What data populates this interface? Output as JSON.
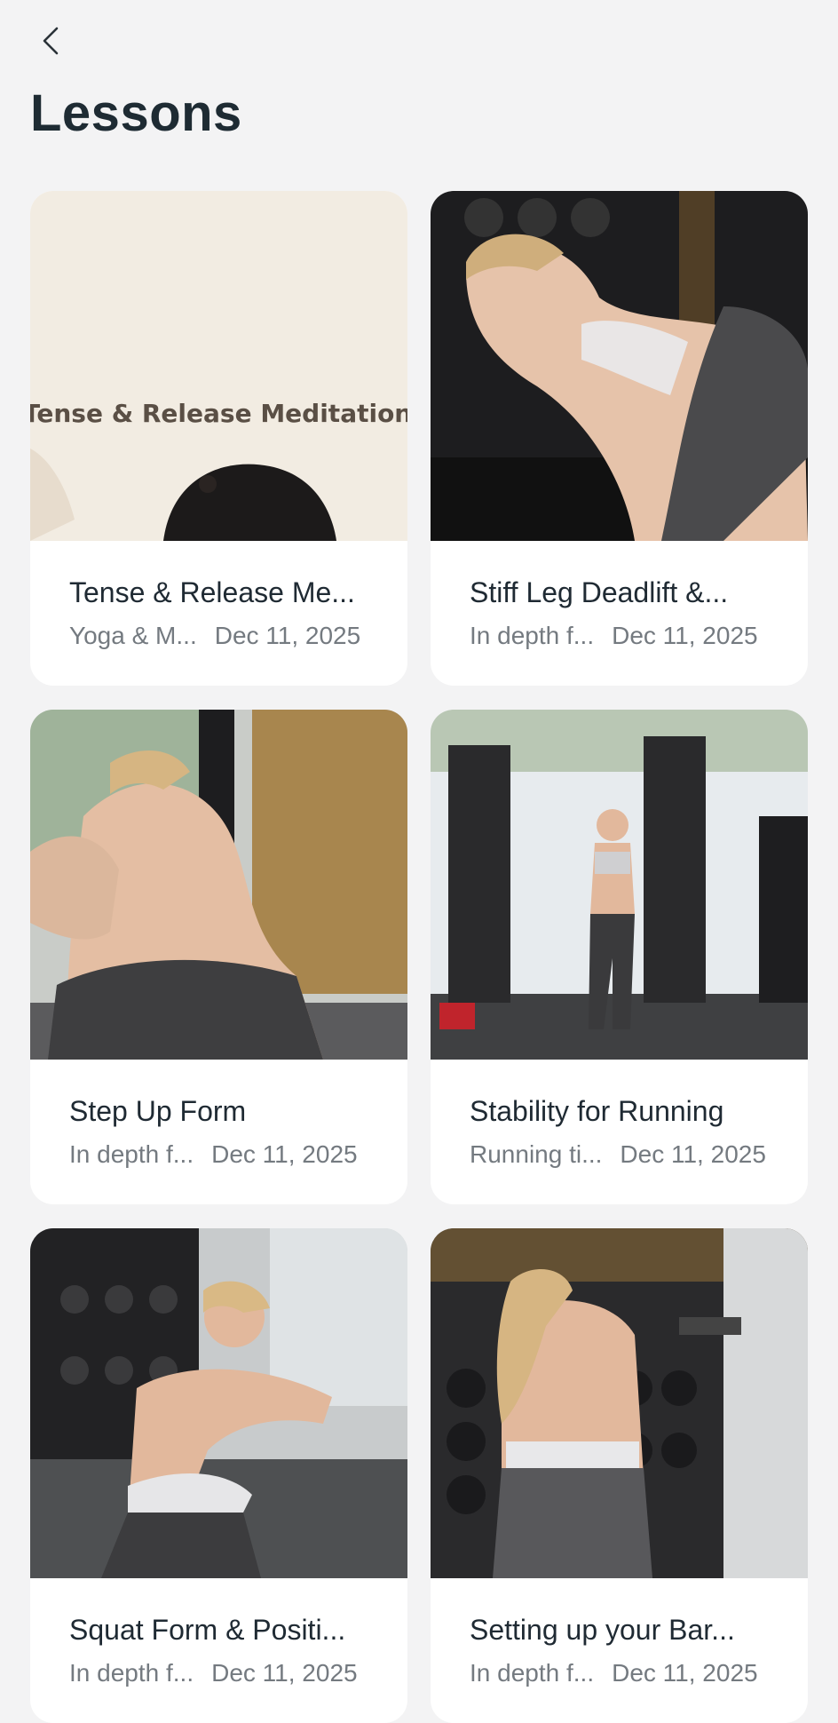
{
  "header": {
    "back_label": "Back",
    "title": "Lessons"
  },
  "lessons": [
    {
      "title": "Tense & Release Me...",
      "category": "Yoga & M...",
      "date": "Dec 11, 2025",
      "thumb_text": "Tense & Release Meditation"
    },
    {
      "title": "Stiff Leg Deadlift &...",
      "category": "In depth f...",
      "date": "Dec 11, 2025"
    },
    {
      "title": "Step Up Form",
      "category": "In depth f...",
      "date": "Dec 11, 2025"
    },
    {
      "title": "Stability for Running",
      "category": "Running ti...",
      "date": "Dec 11, 2025"
    },
    {
      "title": "Squat Form & Positi...",
      "category": "In depth f...",
      "date": "Dec 11, 2025"
    },
    {
      "title": "Setting up your Bar...",
      "category": "In depth f...",
      "date": "Dec 11, 2025"
    }
  ]
}
